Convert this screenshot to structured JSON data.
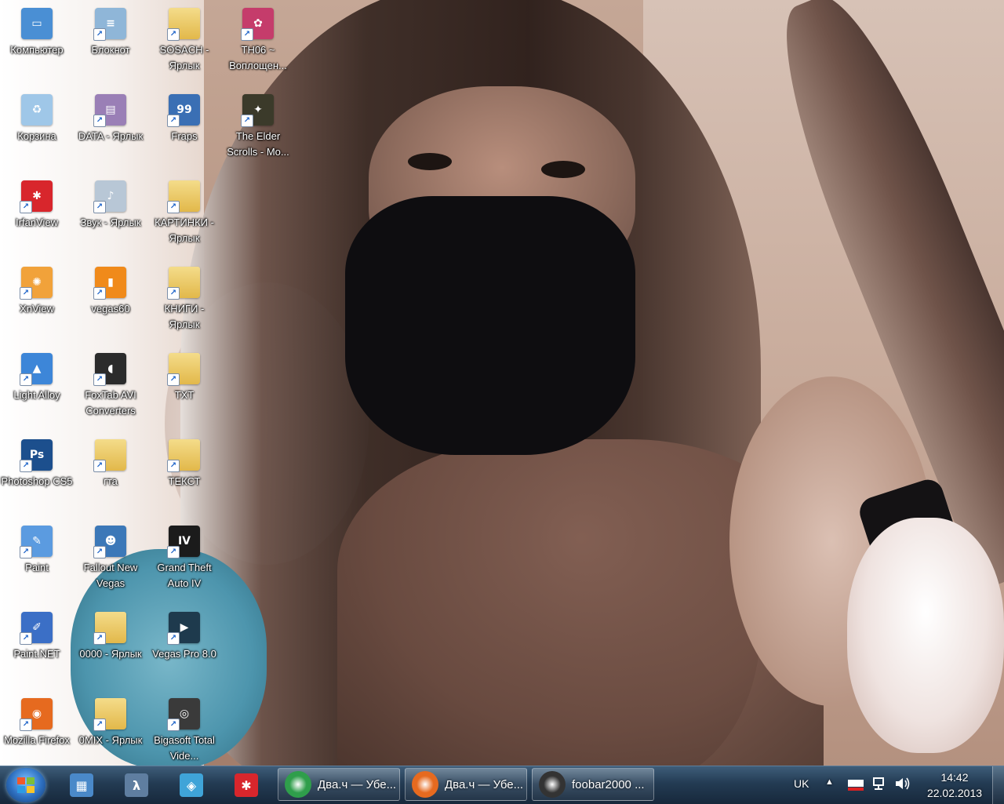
{
  "desktop": {
    "icons": [
      {
        "label": "Компьютер",
        "glyph": "monitor-icon",
        "color": "#4a8fd4"
      },
      {
        "label": "Корзина",
        "glyph": "recycle-bin-icon",
        "color": "#9fc7e8"
      },
      {
        "label": "IrfanView",
        "glyph": "irfanview-icon",
        "color": "#d8262c"
      },
      {
        "label": "XnView",
        "glyph": "xnview-icon",
        "color": "#f1a23a"
      },
      {
        "label": "Light Alloy",
        "glyph": "light-alloy-icon",
        "color": "#3d86d8"
      },
      {
        "label": "Photoshop CS5",
        "glyph": "photoshop-icon",
        "color": "#1c4f8d"
      },
      {
        "label": "Paint",
        "glyph": "paint-icon",
        "color": "#5b9be0"
      },
      {
        "label": "Paint.NET",
        "glyph": "paintnet-icon",
        "color": "#3b6fc6"
      },
      {
        "label": "Mozilla Firefox",
        "glyph": "firefox-icon",
        "color": "#e66a1f"
      },
      {
        "label": "Блокнот",
        "glyph": "notepad-icon",
        "color": "#8fb6d8"
      },
      {
        "label": "DATA - Ярлык",
        "glyph": "drive-icon",
        "color": "#9a7fb6"
      },
      {
        "label": "Звук - Ярлык",
        "glyph": "speaker-icon",
        "color": "#b8c7d6"
      },
      {
        "label": "vegas60",
        "glyph": "vegas-icon",
        "color": "#f08a1a"
      },
      {
        "label": "FoxTab AVI Converters",
        "glyph": "foxtab-icon",
        "color": "#2b2b2b"
      },
      {
        "label": "гта",
        "glyph": "folder-icon",
        "color": "#e7c25a"
      },
      {
        "label": "Fallout New Vegas",
        "glyph": "fallout-icon",
        "color": "#3c78b8"
      },
      {
        "label": "0000 - Ярлык",
        "glyph": "folder-shortcut-icon",
        "color": "#e7c25a"
      },
      {
        "label": "0MIX - Ярлык",
        "glyph": "folder-shortcut-icon",
        "color": "#c9302c"
      },
      {
        "label": "SOSACH - Ярлык",
        "glyph": "folder-shortcut-icon",
        "color": "#e7c25a"
      },
      {
        "label": "Fraps",
        "glyph": "fraps-icon",
        "color": "#3a6fb4"
      },
      {
        "label": "КАРТИНКИ - Ярлык",
        "glyph": "folder-shortcut-icon",
        "color": "#e7c25a"
      },
      {
        "label": "КНИГИ - Ярлык",
        "glyph": "folder-shortcut-icon",
        "color": "#e7c25a"
      },
      {
        "label": "TXT",
        "glyph": "folder-icon",
        "color": "#e7c25a"
      },
      {
        "label": "ТЕКСТ",
        "glyph": "folder-icon",
        "color": "#e7c25a"
      },
      {
        "label": "Grand Theft Auto IV",
        "glyph": "gta-iv-icon",
        "color": "#1b1b1b"
      },
      {
        "label": "Vegas Pro 8.0",
        "glyph": "vegas-pro-icon",
        "color": "#1e3a4d"
      },
      {
        "label": "Bigasoft Total Vide...",
        "glyph": "bigasoft-icon",
        "color": "#3a3a3a"
      },
      {
        "label": "TH06 ~ Воплощен...",
        "glyph": "touhou-icon",
        "color": "#c53c6b"
      },
      {
        "label": "The Elder Scrolls - Mo...",
        "glyph": "elder-scrolls-icon",
        "color": "#3b3a2a"
      }
    ]
  },
  "taskbar": {
    "start_label": "Start",
    "pinned": [
      {
        "name": "control-panel-icon",
        "color": "#4a89c9",
        "glyph": "▦"
      },
      {
        "name": "lambda-app-icon",
        "color": "#5f7ea0",
        "glyph": "λ"
      },
      {
        "name": "network-app-icon",
        "color": "#3fa4d8",
        "glyph": "◈"
      },
      {
        "name": "irfanview-icon",
        "color": "#d8262c",
        "glyph": "✱"
      }
    ],
    "tasks": [
      {
        "title": "Два.ч — Убе...",
        "icon": "chrome-icon",
        "color": "#2f9e4b"
      },
      {
        "title": "Два.ч — Убе...",
        "icon": "firefox-icon",
        "color": "#e66a1f"
      },
      {
        "title": "foobar2000 ...",
        "icon": "foobar-icon",
        "color": "#333333"
      }
    ],
    "tray": {
      "language": "UK",
      "time": "14:42",
      "date": "22.02.2013"
    }
  }
}
